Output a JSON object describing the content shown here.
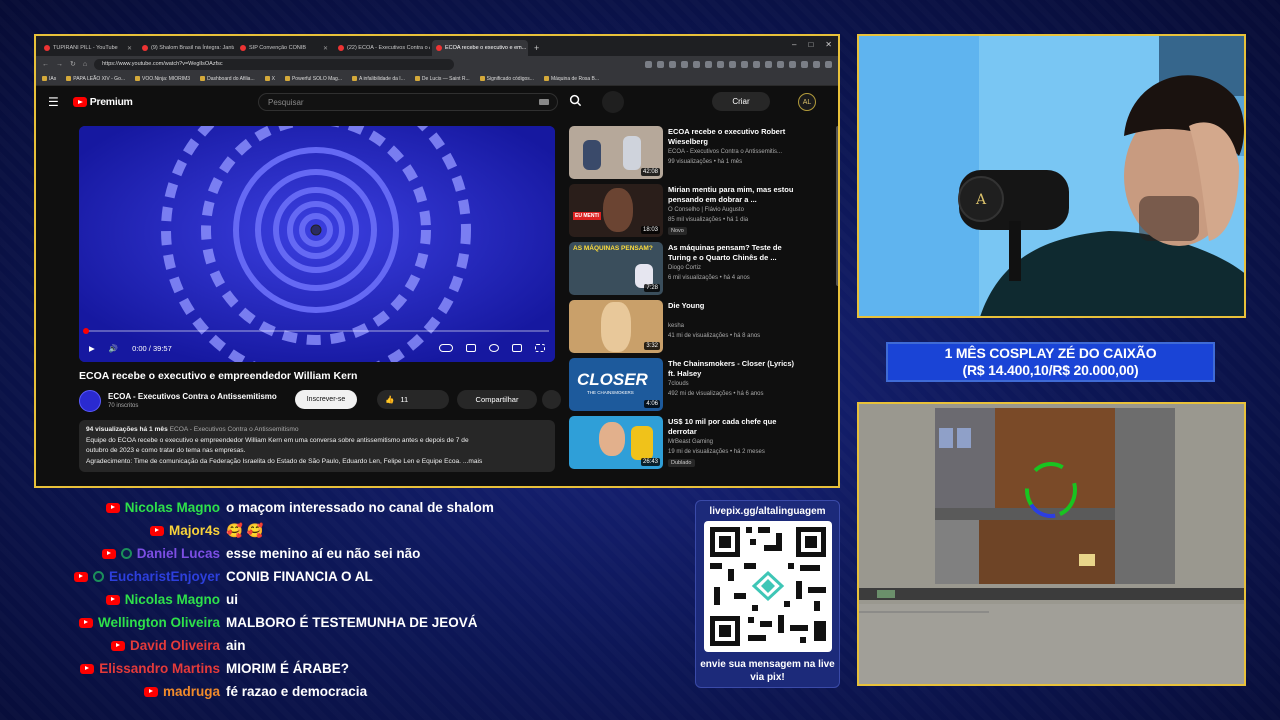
{
  "browser": {
    "tabs": [
      {
        "label": "TUPIRANI PILL - YouTube",
        "active": false
      },
      {
        "label": "(9) Shalom Brasil na Íntegra: Jantar ...",
        "active": false
      },
      {
        "label": "SIP Convenção CONIB",
        "active": false
      },
      {
        "label": "(22) ECOA - Executivos Contra o Anti...",
        "active": false
      },
      {
        "label": "ECOA recebe o executivo e em...",
        "active": true
      }
    ],
    "url": "https://www.youtube.com/watch?v=WeglIsOAzfsc",
    "bookmarks": [
      "IAs",
      "PAPA LEÃO XIV - Go...",
      "VOO.Ninja: MIORIM3",
      "Dashboard do Afilia...",
      "X",
      "Powerful SOLO Mag...",
      "A infalibilidade da I...",
      "De Lucis — Saint R...",
      "Significado códigos...",
      "Máquina de Rosa B..."
    ],
    "new_tab": "+",
    "window_controls": [
      "–",
      "□",
      "✕"
    ]
  },
  "youtube": {
    "logo_text": "Premium",
    "search_placeholder": "Pesquisar",
    "create_label": "Criar",
    "account_initials": "AL",
    "video": {
      "time": "0:00 / 39:57",
      "title": "ECOA recebe o executivo e empreendedor William Kern",
      "channel": "ECOA - Executivos Contra o Antissemitismo",
      "subscribers": "70 inscritos",
      "subscribe_label": "Inscrever-se",
      "likes": "11",
      "share_label": "Compartilhar",
      "desc_stats": "94 visualizações  há 1 mês",
      "desc_tag": "ECOA - Executivos Contra o Antissemitismo",
      "desc_line1": "Equipe do ECOA recebe o executivo e empreendedor William Kern em uma conversa sobre antissemitismo antes e depois de 7 de",
      "desc_line2": "outubro de 2023 e como tratar do tema nas empresas.",
      "desc_line3": "Agradecimento: Time de comunicação da Federação Israelita do Estado de São Paulo, Eduardo Len, Felipe Len e Equipe Ecoa.",
      "desc_more": "...mais"
    },
    "recommended": [
      {
        "title": "ECOA recebe o executivo Robert Wieselberg",
        "channel": "ECOA - Executivos Contra o Antissemitis...",
        "meta": "99 visualizações • há 1 mês",
        "duration": "42:08",
        "badge": "",
        "thumb_color": "#b6a89a"
      },
      {
        "title": "Mirian mentiu para mim, mas estou pensando em dobrar a ...",
        "channel": "O Conselho | Flávio Augusto",
        "meta": "85 mil visualizações • há 1 dia",
        "duration": "18:03",
        "badge": "Novo",
        "thumb_color": "#2a1e1a"
      },
      {
        "title": "As máquinas pensam? Teste de Turing e o Quarto Chinês de ...",
        "channel": "Diogo Cortiz",
        "meta": "6 mil visualizações • há 4 anos",
        "duration": "7:28",
        "badge": "",
        "thumb_color": "#3a4e5c"
      },
      {
        "title": "Die Young",
        "channel": "kesha",
        "meta": "41 mi de visualizações • há 8 anos",
        "duration": "3:32",
        "badge": "",
        "thumb_color": "#c9a06a"
      },
      {
        "title": "The Chainsmokers - Closer (Lyrics) ft. Halsey",
        "channel": "7clouds",
        "meta": "492 mi de visualizações • há 6 anos",
        "duration": "4:06",
        "badge": "",
        "thumb_color": "#1d5a9c"
      },
      {
        "title": "US$ 10 mil por cada chefe que derrotar",
        "channel": "MrBeast Gaming",
        "meta": "19 mi de visualizações • há 2 meses",
        "duration": "26:43",
        "badge": "Dublado",
        "thumb_color": "#2f9fd8"
      }
    ],
    "thumb_texts": {
      "closer": "CLOSER",
      "closer_sub": "THE CHAINSMOKERS",
      "machines": "AS MÁQUINAS PENSAM?",
      "eumenti": "EU MENTI"
    }
  },
  "goal": {
    "line1": "1 MÊS COSPLAY ZÉ DO CAIXÃO",
    "line2": "(R$ 14.400,10/R$ 20.000,00)"
  },
  "chat": [
    {
      "name": "Nicolas Magno",
      "color": "#2ee04a",
      "member": false,
      "message": "o maçom interessado no canal de shalom"
    },
    {
      "name": "Major4s",
      "color": "#f7d23a",
      "member": false,
      "message": "🥰 🥰"
    },
    {
      "name": "Daniel Lucas",
      "color": "#7c4ee4",
      "member": true,
      "message": "esse menino aí eu não sei não"
    },
    {
      "name": "EucharistEnjoyer",
      "color": "#2d3fdc",
      "member": true,
      "message": "CONIB FINANCIA O AL"
    },
    {
      "name": "Nicolas Magno",
      "color": "#2ee04a",
      "member": false,
      "message": "ui"
    },
    {
      "name": "Wellington Oliveira",
      "color": "#2ee04a",
      "member": false,
      "message": "MALBORO É TESTEMUNHA DE JEOVÁ"
    },
    {
      "name": "David Oliveira",
      "color": "#e43a3a",
      "member": false,
      "message": "ain"
    },
    {
      "name": "Elissandro Martins",
      "color": "#e43a3a",
      "member": false,
      "message": "MIORIM É ÁRABE?"
    },
    {
      "name": "madruga",
      "color": "#f08a2a",
      "member": false,
      "message": "fé razao e democracia"
    }
  ],
  "donation": {
    "url": "livepix.gg/altalinguagem",
    "message": "envie sua mensagem na live via pix!"
  },
  "colors": {
    "accent_border": "#e8c13a",
    "goal_bg": "#1a44d6",
    "youtube_red": "#ff0000"
  }
}
